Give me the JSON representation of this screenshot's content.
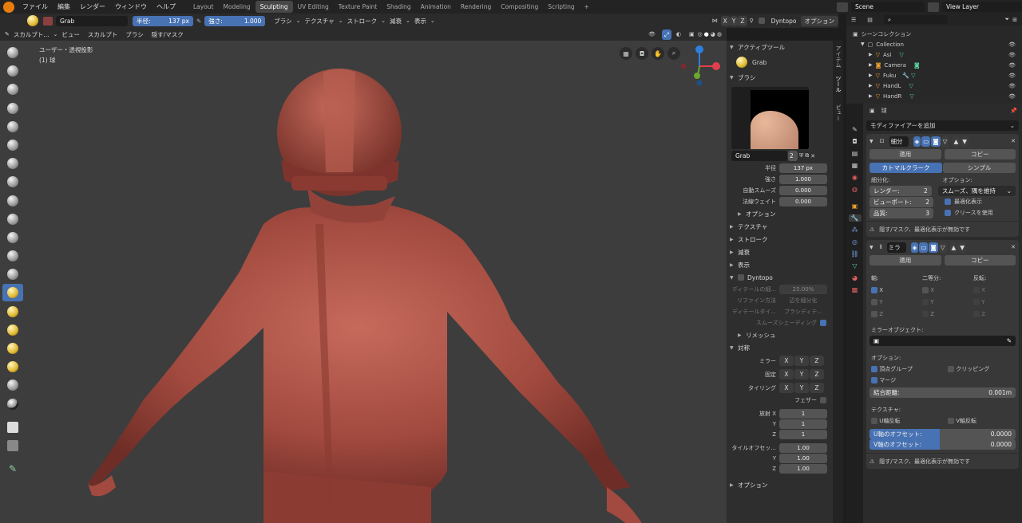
{
  "topbar": {
    "menus": [
      "ファイル",
      "編集",
      "レンダー",
      "ウィンドウ",
      "ヘルプ"
    ],
    "workspaces": [
      "Layout",
      "Modeling",
      "Sculpting",
      "UV Editing",
      "Texture Paint",
      "Shading",
      "Animation",
      "Rendering",
      "Compositing",
      "Scripting"
    ],
    "active_workspace": "Sculpting",
    "add_tab": "+",
    "scene": "Scene",
    "view_layer": "View Layer"
  },
  "tool_header": {
    "brush_name": "Grab",
    "radius_label": "半径:",
    "radius_value": "137 px",
    "strength_label": "強さ:",
    "strength_value": "1.000",
    "menus": [
      "ブラシ",
      "テクスチャ",
      "ストローク",
      "減衰",
      "表示"
    ],
    "axes": [
      "X",
      "Y",
      "Z"
    ],
    "dyntopo": "Dyntopo",
    "options": "オプション"
  },
  "viewport_header": {
    "mode": "スカルプト...",
    "menus": [
      "ビュー",
      "スカルプト",
      "ブラシ",
      "隠す/マスク"
    ]
  },
  "viewport": {
    "view_name": "ユーザー・透視投影",
    "object_name": "(1) 球"
  },
  "npanel": {
    "active_tool_header": "アクティブツール",
    "active_tool_name": "Grab",
    "brush_header": "ブラシ",
    "brush_name": "Grab",
    "brush_users": "2",
    "radius_label": "半径",
    "radius_value": "137 px",
    "strength_label": "強さ",
    "strength_value": "1.000",
    "autosmooth_label": "自動スムーズ",
    "autosmooth_value": "0.000",
    "normal_weight_label": "法線ウェイト",
    "normal_weight_value": "0.000",
    "options_sub": "オプション",
    "sections": [
      "テクスチャ",
      "ストローク",
      "減衰",
      "表示"
    ],
    "dyntopo_header": "Dyntopo",
    "detail_size_label": "ディテールの細...",
    "detail_size_value": "25.00%",
    "refine_label": "リファイン方法",
    "refine_value": "辺を細分化",
    "detail_type_label": "ディテールタイ...",
    "detail_type_value": "ブラシディテ...",
    "smooth_shading_label": "スムーズシェーディング",
    "remesh": "リメッシュ",
    "symmetry_header": "対称",
    "mirror_label": "ミラー",
    "lock_label": "固定",
    "tiling_label": "タイリング",
    "feather_label": "フェザー",
    "radial_label": "放射 X",
    "radial_values": [
      "1",
      "1",
      "1"
    ],
    "tile_offset_label": "タイルオフセッ...",
    "tile_offset_values": [
      "1.00",
      "1.00",
      "1.00"
    ],
    "axis_y": "Y",
    "axis_z": "Z",
    "options_footer": "オプション"
  },
  "side_tabs": [
    "アイテム",
    "ツール",
    "ビュー"
  ],
  "outliner": {
    "root": "シーンコレクション",
    "collection": "Collection",
    "items": [
      "Asi",
      "Camera",
      "Fuku",
      "HandL",
      "HandR"
    ]
  },
  "properties": {
    "object": "球",
    "add_modifier": "モディファイアーを追加",
    "subsurf": {
      "name": "細分",
      "apply": "適用",
      "copy": "コピー",
      "tab_catmull": "カトマルクラーク",
      "tab_simple": "シンプル",
      "subdiv_label": "細分化:",
      "render_label": "レンダー:",
      "render_value": "2",
      "viewport_label": "ビューポート:",
      "viewport_value": "2",
      "quality_label": "品質:",
      "quality_value": "3",
      "options_label": "オプション:",
      "uv_smooth": "スムーズ、隅を維持",
      "optimal_display": "最適化表示",
      "use_crease": "クリースを使用",
      "warning": "隠す/マスク、最適化表示が無効です"
    },
    "mirror": {
      "name": "ミラ",
      "apply": "適用",
      "copy": "コピー",
      "axis_label": "軸:",
      "bisect_label": "二等分:",
      "flip_label": "反転:",
      "axes": [
        "X",
        "Y",
        "Z"
      ],
      "mirror_object_label": "ミラーオブジェクト:",
      "options_label": "オプション:",
      "vertex_groups": "頂点グループ",
      "clipping": "クリッピング",
      "merge": "マージ",
      "merge_distance_label": "結合距離:",
      "merge_distance_value": "0.001m",
      "texture_label": "テクスチャ:",
      "u_flip": "U軸反転",
      "v_flip": "V軸反転",
      "u_offset_label": "U軸のオフセット:",
      "u_offset_value": "0.0000",
      "v_offset_label": "V軸のオフセット:",
      "v_offset_value": "0.0000",
      "warning": "隠す/マスク、最適化表示が無効です"
    }
  }
}
